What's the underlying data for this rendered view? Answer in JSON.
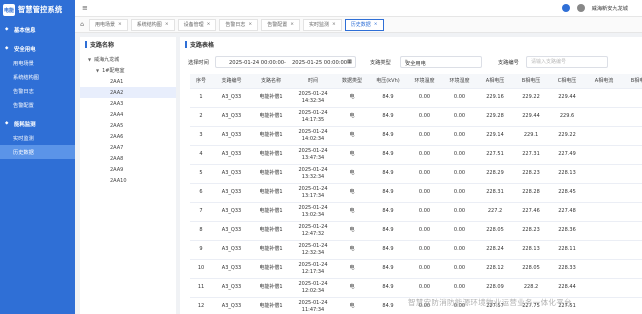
{
  "app": {
    "logo_text": "电能",
    "title": "智慧管控系统"
  },
  "sidebar": {
    "items": [
      {
        "label": "基本信息",
        "type": "group",
        "active": false
      },
      {
        "label": "安全用电",
        "type": "group",
        "active": false
      },
      {
        "label": "用电场景",
        "type": "sub",
        "active": false
      },
      {
        "label": "系统结构图",
        "type": "sub",
        "active": false
      },
      {
        "label": "告警日志",
        "type": "sub",
        "active": false
      },
      {
        "label": "告警配置",
        "type": "sub",
        "active": false
      },
      {
        "label": "能耗监测",
        "type": "group",
        "active": false
      },
      {
        "label": "实时监测",
        "type": "sub",
        "active": false
      },
      {
        "label": "历史数据",
        "type": "sub",
        "active": true
      }
    ]
  },
  "topbar": {
    "hamburger": "≡",
    "user_name": "威海新安九龙城"
  },
  "tabs": [
    {
      "label": "用电场景"
    },
    {
      "label": "系统结构图"
    },
    {
      "label": "设备管理"
    },
    {
      "label": "告警日志"
    },
    {
      "label": "告警配置"
    },
    {
      "label": "实时监测"
    },
    {
      "label": "历史数据",
      "active": true
    }
  ],
  "tree_panel": {
    "title": "支路名称",
    "nodes": [
      {
        "label": "威海九龙城",
        "level": 0,
        "caret": "▼"
      },
      {
        "label": "1#配电室",
        "level": 1,
        "caret": "▼"
      },
      {
        "label": "2AA1",
        "level": 2
      },
      {
        "label": "2AA2",
        "level": 2,
        "selected": true
      },
      {
        "label": "2AA3",
        "level": 2
      },
      {
        "label": "2AA4",
        "level": 2
      },
      {
        "label": "2AA5",
        "level": 2
      },
      {
        "label": "2AA6",
        "level": 2
      },
      {
        "label": "2AA7",
        "level": 2
      },
      {
        "label": "2AA8",
        "level": 2
      },
      {
        "label": "2AA9",
        "level": 2
      },
      {
        "label": "2AA10",
        "level": 2
      }
    ]
  },
  "main_panel": {
    "title": "支路表格",
    "filters": {
      "time_label": "选择时间",
      "start_date": "2025-01-24 00:00:00",
      "separator": "-",
      "end_date": "2025-01-25 00:00:00",
      "branch_type_label": "支路类型",
      "branch_type_value": "安全用电",
      "branch_code_label": "支路编号",
      "branch_code_placeholder": "请输入支路编号"
    },
    "columns": [
      "序号",
      "支路编号",
      "支路名称",
      "时间",
      "数据类型",
      "电压(kVh)",
      "环境温度",
      "环境湿度",
      "A相电压",
      "B相电压",
      "C相电压",
      "A相电流",
      "B相电"
    ],
    "rows": [
      {
        "no": "1",
        "code": "A3_Q33",
        "name": "电能补偿1",
        "date": "2025-01-24",
        "time": "14:32:34",
        "type": "电",
        "kvh": "84.9",
        "temp": "0.00",
        "hum": "0.00",
        "ua": "229.16",
        "ub": "229.22",
        "uc": "229.44"
      },
      {
        "no": "2",
        "code": "A3_Q33",
        "name": "电能补偿1",
        "date": "2025-01-24",
        "time": "14:17:35",
        "type": "电",
        "kvh": "84.9",
        "temp": "0.00",
        "hum": "0.00",
        "ua": "229.28",
        "ub": "229.44",
        "uc": "229.6"
      },
      {
        "no": "3",
        "code": "A3_Q33",
        "name": "电能补偿1",
        "date": "2025-01-24",
        "time": "14:02:34",
        "type": "电",
        "kvh": "84.9",
        "temp": "0.00",
        "hum": "0.00",
        "ua": "229.14",
        "ub": "229.1",
        "uc": "229.22"
      },
      {
        "no": "4",
        "code": "A3_Q33",
        "name": "电能补偿1",
        "date": "2025-01-24",
        "time": "13:47:34",
        "type": "电",
        "kvh": "84.9",
        "temp": "0.00",
        "hum": "0.00",
        "ua": "227.51",
        "ub": "227.31",
        "uc": "227.49"
      },
      {
        "no": "5",
        "code": "A3_Q33",
        "name": "电能补偿1",
        "date": "2025-01-24",
        "time": "13:32:34",
        "type": "电",
        "kvh": "84.9",
        "temp": "0.00",
        "hum": "0.00",
        "ua": "228.29",
        "ub": "228.23",
        "uc": "228.13"
      },
      {
        "no": "6",
        "code": "A3_Q33",
        "name": "电能补偿1",
        "date": "2025-01-24",
        "time": "13:17:34",
        "type": "电",
        "kvh": "84.9",
        "temp": "0.00",
        "hum": "0.00",
        "ua": "228.31",
        "ub": "228.28",
        "uc": "228.45"
      },
      {
        "no": "7",
        "code": "A3_Q33",
        "name": "电能补偿1",
        "date": "2025-01-24",
        "time": "13:02:34",
        "type": "电",
        "kvh": "84.9",
        "temp": "0.00",
        "hum": "0.00",
        "ua": "227.2",
        "ub": "227.46",
        "uc": "227.48"
      },
      {
        "no": "8",
        "code": "A3_Q33",
        "name": "电能补偿1",
        "date": "2025-01-24",
        "time": "12:47:32",
        "type": "电",
        "kvh": "84.9",
        "temp": "0.00",
        "hum": "0.00",
        "ua": "228.05",
        "ub": "228.23",
        "uc": "228.36"
      },
      {
        "no": "9",
        "code": "A3_Q33",
        "name": "电能补偿1",
        "date": "2025-01-24",
        "time": "12:32:34",
        "type": "电",
        "kvh": "84.9",
        "temp": "0.00",
        "hum": "0.00",
        "ua": "228.24",
        "ub": "228.13",
        "uc": "228.11"
      },
      {
        "no": "10",
        "code": "A3_Q33",
        "name": "电能补偿1",
        "date": "2025-01-24",
        "time": "12:17:34",
        "type": "电",
        "kvh": "84.9",
        "temp": "0.00",
        "hum": "0.00",
        "ua": "228.12",
        "ub": "228.05",
        "uc": "228.33"
      },
      {
        "no": "11",
        "code": "A3_Q33",
        "name": "电能补偿1",
        "date": "2025-01-24",
        "time": "12:02:34",
        "type": "电",
        "kvh": "84.9",
        "temp": "0.00",
        "hum": "0.00",
        "ua": "228.09",
        "ub": "228.2",
        "uc": "228.44"
      },
      {
        "no": "12",
        "code": "A3_Q33",
        "name": "电能补偿1",
        "date": "2025-01-24",
        "time": "11:47:34",
        "type": "电",
        "kvh": "84.9",
        "temp": "0.00",
        "hum": "0.00",
        "ua": "227.57",
        "ub": "227.75",
        "uc": "227.51"
      }
    ]
  },
  "watermark": "智慧安防消防能源环境物业运营业务一体化平台"
}
